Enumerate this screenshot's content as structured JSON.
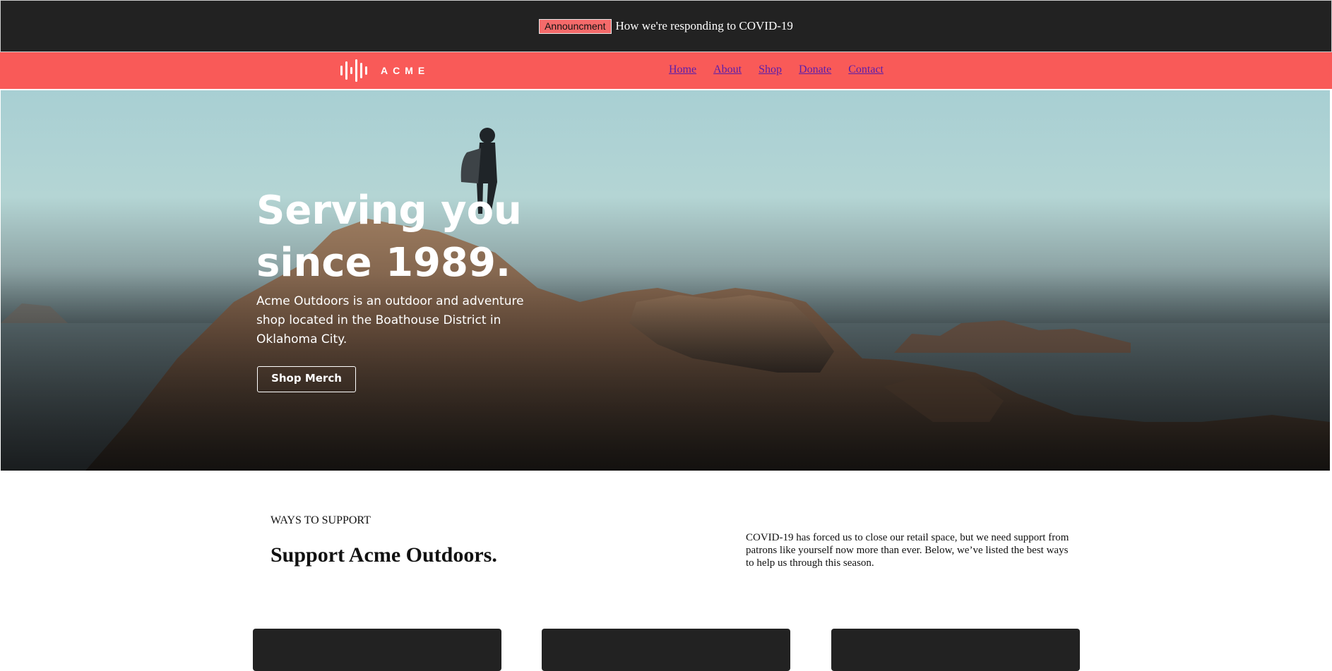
{
  "announcement": {
    "badge": "Announcment",
    "message": "How we're responding to COVID-19"
  },
  "header": {
    "logo_text": "ACME",
    "nav": [
      "Home",
      "About",
      "Shop",
      "Donate",
      "Contact"
    ]
  },
  "hero": {
    "title": "Serving you since 1989.",
    "description": "Acme Outdoors is an outdoor and adventure shop located in the Boathouse District in Oklahoma City.",
    "button_label": "Shop Merch"
  },
  "support": {
    "eyebrow": "WAYS TO SUPPORT",
    "title": "Support Acme Outdoors.",
    "description": "COVID-19 has forced us to close our retail space, but we need support from patrons like yourself now more than ever. Below, we’ve listed the best ways to help us through this season."
  },
  "colors": {
    "brand": "#f95a58",
    "dark": "#222222",
    "badge": "#f46a6a",
    "link": "#5a1eaa"
  }
}
